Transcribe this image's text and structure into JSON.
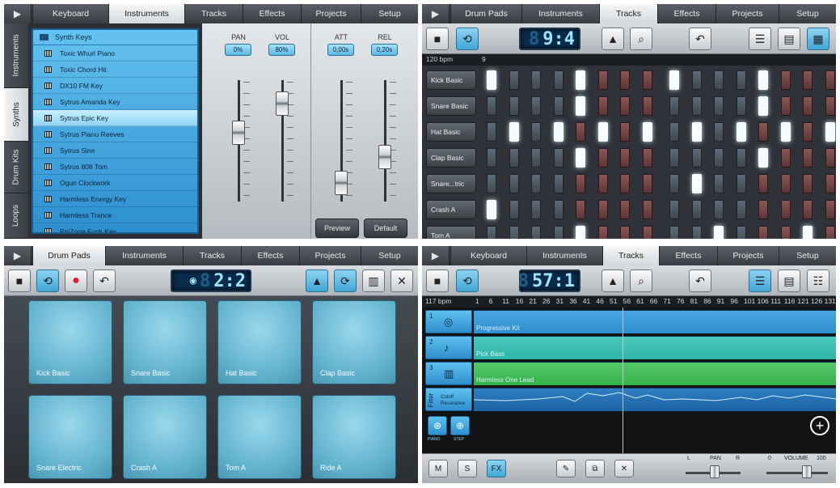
{
  "panel1": {
    "tabs": [
      "Keyboard",
      "Instruments",
      "Tracks",
      "Effects",
      "Projects",
      "Setup"
    ],
    "active_tab": "Instruments",
    "side_tabs": [
      "Instruments",
      "Synths",
      "Drum Kits",
      "Loops"
    ],
    "active_side_tab": "Synths",
    "library_title": "Synth Keys",
    "presets": [
      "Toxic Whurl Piano",
      "Toxic Chord Hit",
      "DX10 FM Key",
      "Sytrus Amanda Key",
      "Sytrus Epic Key",
      "Sytrus Pianu Reeves",
      "Sytrus Sine",
      "Sytrus 808 Tom",
      "Ogun Clockwork",
      "Harmless Energy Key",
      "Harmless Trance",
      "PoiZone Funk Key"
    ],
    "selected_preset": "Sytrus Epic Key",
    "pan_label": "PAN",
    "pan_value": "0%",
    "vol_label": "VOL",
    "vol_value": "80%",
    "att_label": "ATT",
    "att_value": "0,00s",
    "rel_label": "REL",
    "rel_value": "0,20s",
    "preview_label": "Preview",
    "default_label": "Default"
  },
  "panel2": {
    "tabs": [
      "Drum Pads",
      "Instruments",
      "Tracks",
      "Effects",
      "Projects",
      "Setup"
    ],
    "active_tab": "Tracks",
    "lcd": "9:4",
    "bpm": "120 bpm",
    "bar_marker": "9",
    "channels": [
      "Kick Basic",
      "Snare Basic",
      "Hat Basic",
      "Clap Basic",
      "Snare...tric",
      "Crash A",
      "Tom A"
    ],
    "steps": [
      [
        1,
        0,
        0,
        0,
        1,
        0,
        0,
        0,
        1,
        0,
        0,
        0,
        1,
        0,
        0,
        0
      ],
      [
        0,
        0,
        0,
        0,
        1,
        0,
        0,
        0,
        0,
        0,
        0,
        0,
        1,
        0,
        0,
        0
      ],
      [
        0,
        1,
        0,
        1,
        0,
        1,
        0,
        1,
        0,
        1,
        0,
        1,
        0,
        1,
        0,
        1
      ],
      [
        0,
        0,
        0,
        0,
        1,
        0,
        0,
        0,
        0,
        0,
        0,
        0,
        1,
        0,
        0,
        0
      ],
      [
        0,
        0,
        0,
        0,
        0,
        0,
        0,
        0,
        0,
        1,
        0,
        0,
        0,
        0,
        0,
        0
      ],
      [
        1,
        0,
        0,
        0,
        0,
        0,
        0,
        0,
        0,
        0,
        0,
        0,
        0,
        0,
        0,
        0
      ],
      [
        0,
        0,
        0,
        0,
        1,
        0,
        0,
        0,
        0,
        0,
        1,
        0,
        0,
        0,
        1,
        0
      ]
    ],
    "colors": {
      "step_blue": "#4a5561",
      "step_red": "#7a4545",
      "step_on": "#f6fbff"
    }
  },
  "panel3": {
    "tabs": [
      "Drum Pads",
      "Instruments",
      "Tracks",
      "Effects",
      "Projects",
      "Setup"
    ],
    "active_tab": "Drum Pads",
    "lcd": "2:2",
    "pads": [
      "Kick Basic",
      "Snare Basic",
      "Hat Basic",
      "Clap Basic",
      "Snare Electric",
      "Crash A",
      "Tom A",
      "Ride A"
    ]
  },
  "panel4": {
    "tabs": [
      "Keyboard",
      "Instruments",
      "Tracks",
      "Effects",
      "Projects",
      "Setup"
    ],
    "active_tab": "Tracks",
    "lcd": "57:1",
    "bpm": "117 bpm",
    "ruler": [
      "1",
      "6",
      "11",
      "16",
      "21",
      "26",
      "31",
      "36",
      "41",
      "46",
      "51",
      "56",
      "61",
      "66",
      "71",
      "76",
      "81",
      "86",
      "91",
      "96",
      "101",
      "106",
      "111",
      "116",
      "121",
      "126",
      "131"
    ],
    "tracks": [
      {
        "num": "1",
        "name": "Progressive Kit",
        "color": "#2f8ed0"
      },
      {
        "num": "2",
        "name": "Pick Bass",
        "color": "#2fb5a7"
      },
      {
        "num": "3",
        "name": "Harmless One Lead",
        "color": "#35b24a"
      }
    ],
    "filter_label": "Filter",
    "filter_params": [
      "Cutoff",
      "Resonance"
    ],
    "add_piano_label": "PIANO",
    "add_step_label": "STEP",
    "mute_label": "M",
    "solo_label": "S",
    "fx_label": "FX",
    "pan_label": "PAN",
    "pan_left": "L",
    "pan_right": "R",
    "volume_label": "VOLUME",
    "volume_min": "0",
    "volume_max": "100"
  }
}
